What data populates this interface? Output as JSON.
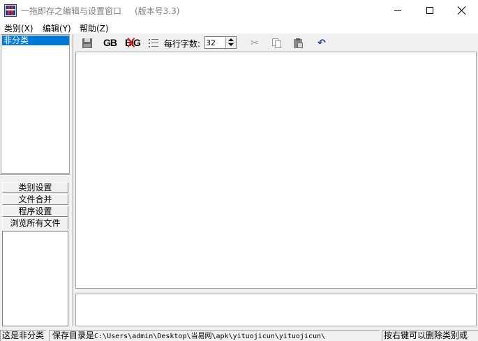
{
  "window": {
    "title": "一拖即存之编辑与设置窗口",
    "version": "(版本号3.3)"
  },
  "menu": [
    "类别(X)",
    "编辑(Y)",
    "帮助(Z)"
  ],
  "categories": {
    "items": [
      "非分类"
    ],
    "selected": "非分类"
  },
  "left_buttons": {
    "category_settings": "类别设置",
    "file_merge": "文件合并",
    "program_settings": "程序设置",
    "browse_all_files": "浏览所有文件"
  },
  "toolbar": {
    "save_icon": "save-icon",
    "gb_label": "GB",
    "big5_label": "BIG",
    "list_icon": "list-icon",
    "chars_per_line_label": "每行字数:",
    "chars_per_line_value": "32",
    "cut_icon": "scissors-icon",
    "copy_icon": "copy-icon",
    "paste_icon": "paste-icon",
    "undo_icon": "undo-icon"
  },
  "status": {
    "category_text": "这是非分类",
    "save_path_label": "保存目录是",
    "save_path": "C:\\Users\\admin\\Desktop\\当易网\\apk\\yituojicun\\yituojicun\\",
    "hint": "按右键可以删除类别或"
  },
  "colors": {
    "selection": "#0078d7",
    "undo": "#1a3a9f",
    "title_text": "#808080",
    "big5_cross": "#e02020"
  }
}
